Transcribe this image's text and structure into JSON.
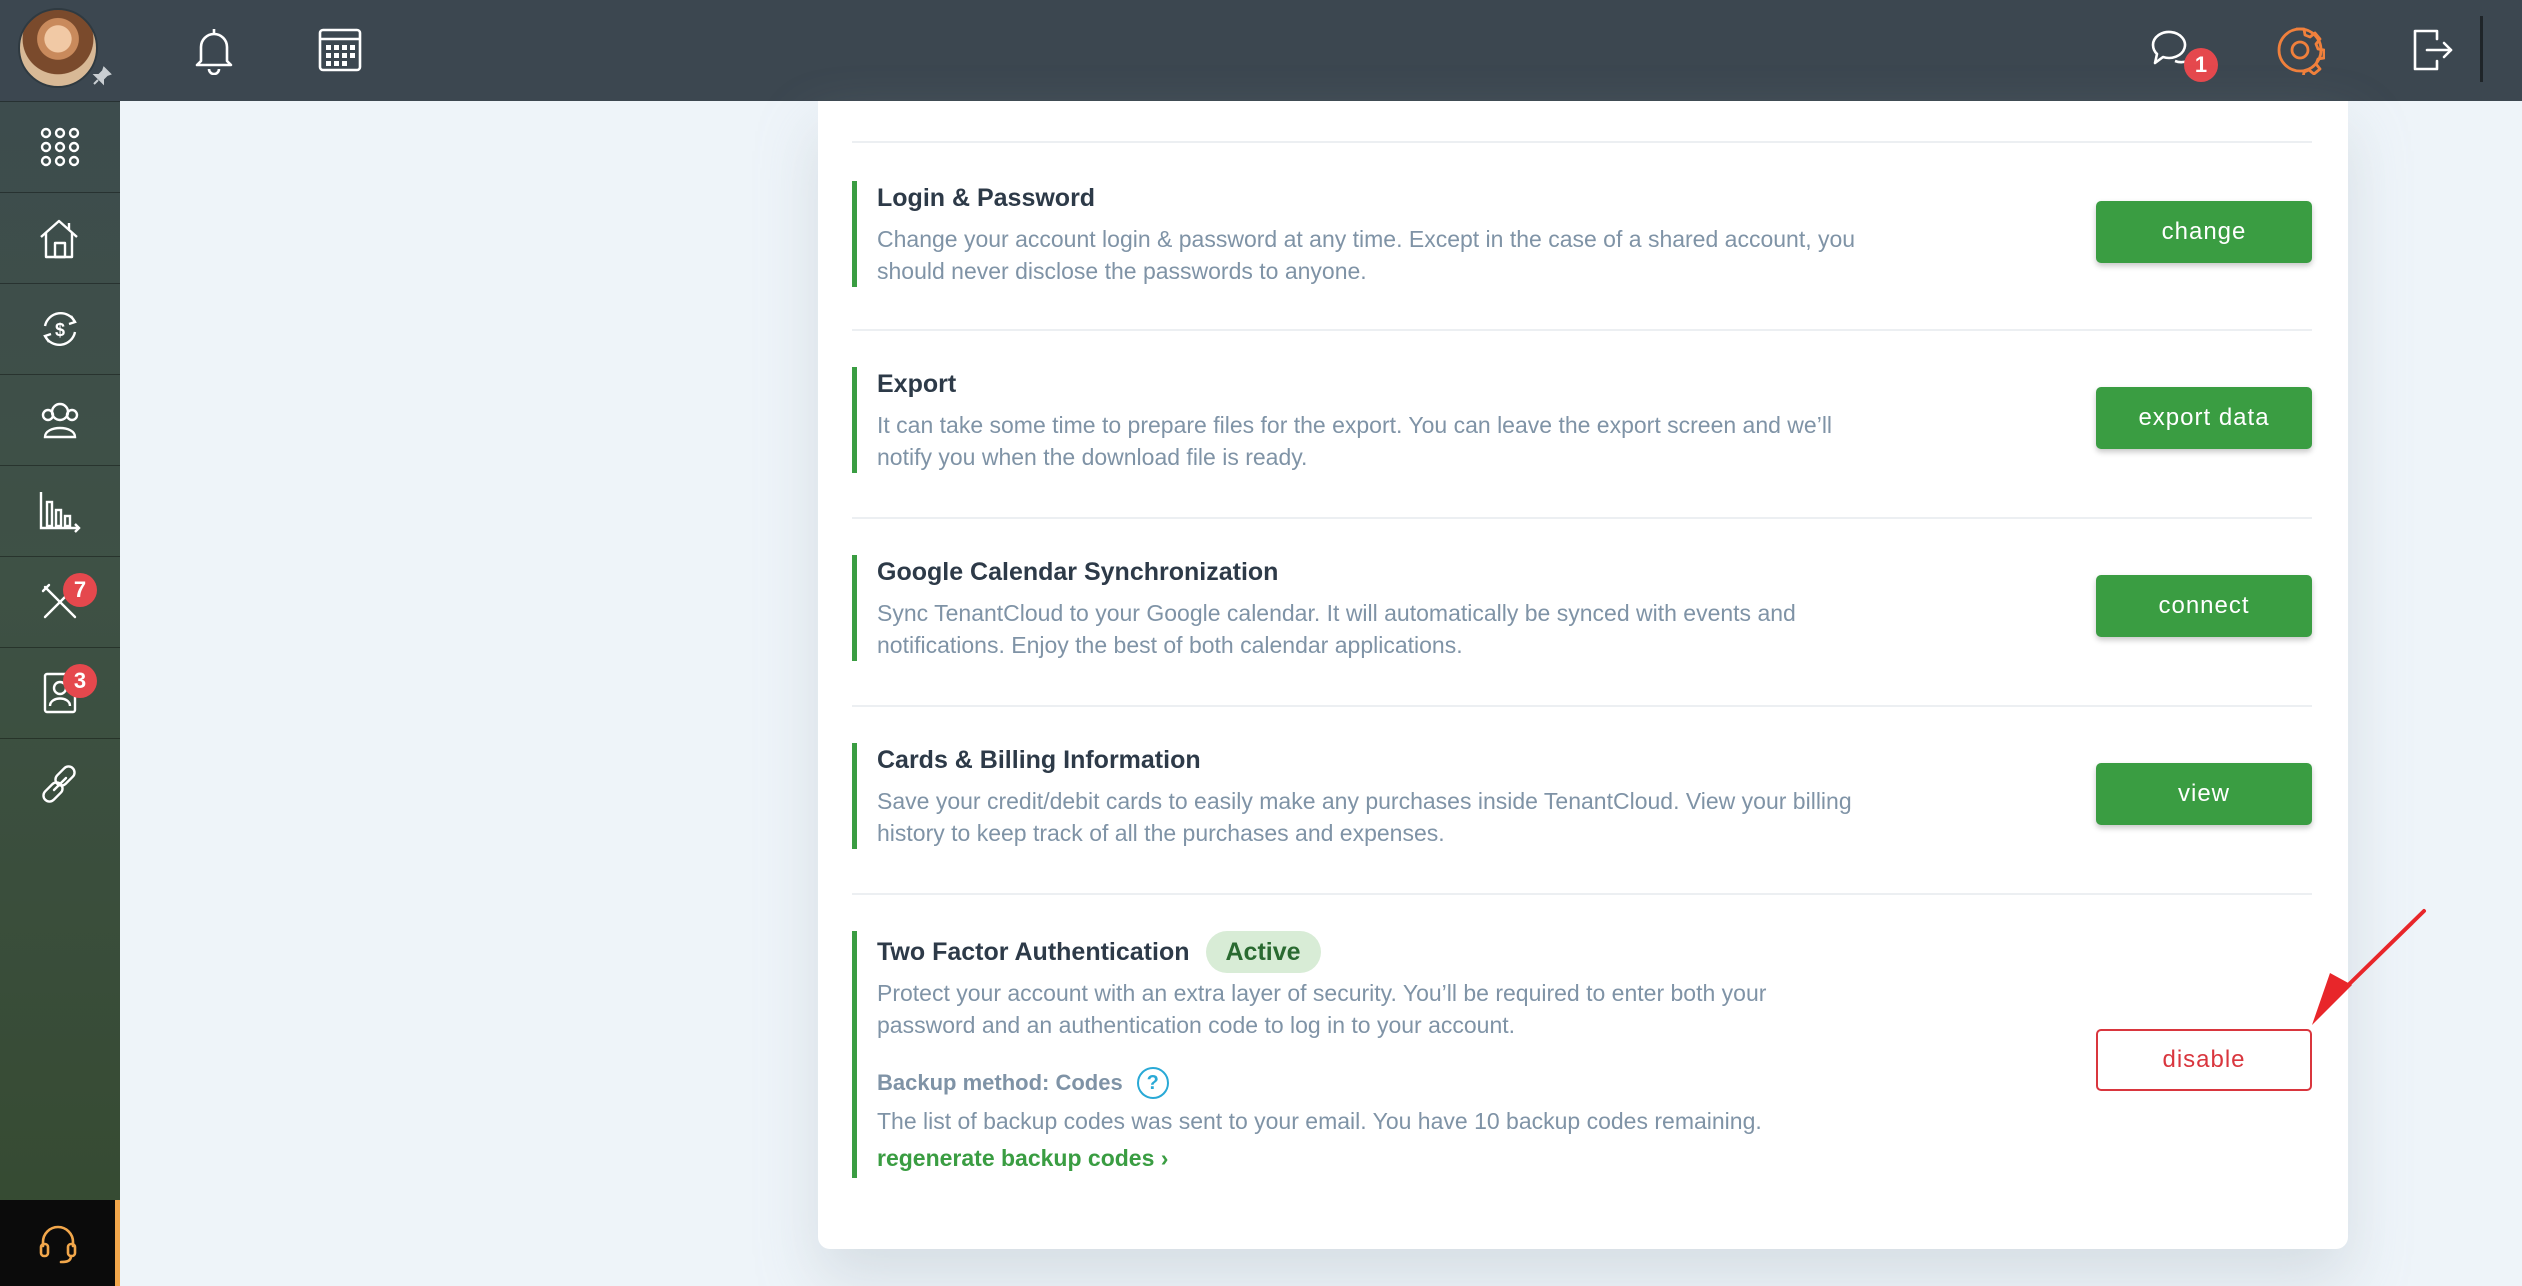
{
  "topbar": {
    "icons": [
      "bell-icon",
      "calendar-icon",
      "chat-icon",
      "settings-icon",
      "logout-icon"
    ],
    "chat_badge": "1"
  },
  "sidebar": {
    "items": [
      {
        "icon": "apps-grid-icon"
      },
      {
        "icon": "properties-icon"
      },
      {
        "icon": "accounting-icon"
      },
      {
        "icon": "people-icon"
      },
      {
        "icon": "reports-icon"
      },
      {
        "icon": "maintenance-icon",
        "badge": "7"
      },
      {
        "icon": "applications-icon",
        "badge": "3"
      },
      {
        "icon": "link-icon"
      }
    ],
    "support_icon": "support-headset-icon"
  },
  "settings": {
    "rows": [
      {
        "title": "Login & Password",
        "desc_line1": "Change your account login & password at any time. Except in the case of a shared account, you",
        "desc_line2": "should never disclose the passwords to anyone.",
        "button": "change"
      },
      {
        "title": "Export",
        "desc_line1": "It can take some time to prepare files for the export. You can leave the export screen and we’ll",
        "desc_line2": "notify you when the download file is ready.",
        "button": "export data"
      },
      {
        "title": "Google Calendar Synchronization",
        "desc_line1": "Sync TenantCloud to your Google calendar. It will automatically be synced with events and",
        "desc_line2": "notifications. Enjoy the best of both calendar applications.",
        "button": "connect"
      },
      {
        "title": "Cards & Billing Information",
        "desc_line1": "Save your credit/debit cards to easily make any purchases inside TenantCloud. View your billing",
        "desc_line2": "history to keep track of all the purchases and expenses.",
        "button": "view"
      }
    ],
    "two_factor": {
      "title": "Two Factor Authentication",
      "status": "Active",
      "desc_line1": "Protect your account with an extra layer of security. You’ll be required to enter both your",
      "desc_line2": "password and an authentication code to log in to your account.",
      "backup_method": "Backup method: Codes",
      "help": "?",
      "backup_info": "The list of backup codes was sent to your email. You have 10 backup codes remaining.",
      "regen_link": "regenerate backup codes ›",
      "button": "disable"
    }
  },
  "colors": {
    "accent_green": "#3a9d42",
    "danger_red": "#d9363e",
    "badge_red": "#e5484d",
    "topbar_bg": "#3c4750",
    "settings_orange": "#f0803c"
  }
}
